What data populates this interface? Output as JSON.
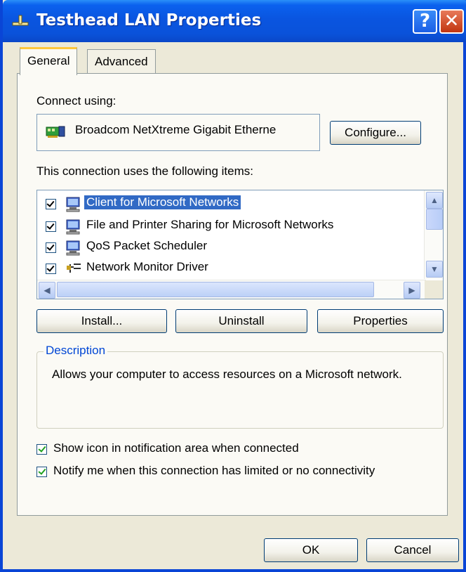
{
  "window": {
    "title": "Testhead LAN Properties",
    "help_glyph": "?",
    "close_glyph": "✕"
  },
  "tabs": [
    {
      "label": "General",
      "active": true
    },
    {
      "label": "Advanced",
      "active": false
    }
  ],
  "connect_using": {
    "label": "Connect using:",
    "adapter": "Broadcom NetXtreme Gigabit Etherne",
    "configure_button": "Configure..."
  },
  "items_section": {
    "label": "This connection uses the following items:",
    "items": [
      {
        "label": "Client for Microsoft Networks",
        "checked": true,
        "selected": true,
        "icon": "network-client-icon"
      },
      {
        "label": "File and Printer Sharing for Microsoft Networks",
        "checked": true,
        "selected": false,
        "icon": "network-service-icon"
      },
      {
        "label": "QoS Packet Scheduler",
        "checked": true,
        "selected": false,
        "icon": "network-service-icon"
      },
      {
        "label": "Network Monitor Driver",
        "checked": true,
        "selected": false,
        "icon": "network-protocol-icon"
      }
    ]
  },
  "buttons": {
    "install": "Install...",
    "uninstall": "Uninstall",
    "properties": "Properties",
    "ok": "OK",
    "cancel": "Cancel"
  },
  "description": {
    "legend": "Description",
    "text": "Allows your computer to access resources on a Microsoft network."
  },
  "options": [
    {
      "label": "Show icon in notification area when connected",
      "checked": true
    },
    {
      "label": "Notify me when this connection has limited or no connectivity",
      "checked": true
    }
  ],
  "colors": {
    "title_bar": "#0a55e0",
    "selection": "#316ac5",
    "group_legend": "#0046d5",
    "tab_highlight": "#ffc73c"
  }
}
